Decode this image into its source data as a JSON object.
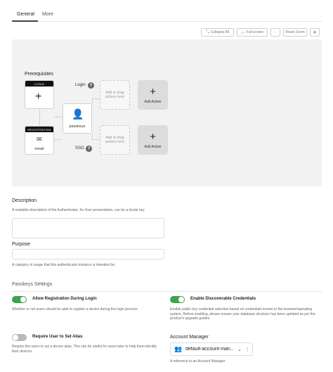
{
  "tabs": [
    {
      "label": "General"
    },
    {
      "label": "More"
    }
  ],
  "toolbar": {
    "collapse_all": "Collapse All",
    "full_screen": "Full screen",
    "more": "⋯",
    "reset_zoom": "Reset Zoom",
    "add": "+"
  },
  "flow": {
    "prerequisites_title": "Prerequisites",
    "login_node_header": "LOGIN",
    "registration_node_header": "REGISTRATION",
    "email_label": "email",
    "passkeys_label": "passkeys",
    "login_label": "Login",
    "sso_label": "SSO",
    "help_glyph": "?",
    "dropzone_text": "Add or drag actions here",
    "add_action_label": "Add Action"
  },
  "form": {
    "description_label": "Description",
    "description_help": "A readable description of the Authenticator, for User presentation, can be a locale key",
    "description_value": "",
    "purpose_label": "Purpose",
    "purpose_value": "",
    "purpose_help": "A category of usage that this authenticator instance is intended for."
  },
  "settings": {
    "section_title": "Passkeys Settings",
    "allow_registration": {
      "label": "Allow Registration During Login",
      "desc": "Whether or not users should be able to register a device during the login process",
      "enabled": true
    },
    "discoverable": {
      "label": "Enable Discoverable Credentials",
      "desc": "Enable public key credential selection based on credentials known to the browser/operating system. Before enabling, please ensure your database structure has been updated as per the product's upgrade guides.",
      "enabled": true
    },
    "require_alias": {
      "label": "Require User to Set Alias",
      "desc": "Require the users to set a device alias. This can be useful for users later to help them identify their devices.",
      "enabled": false
    },
    "account_manager": {
      "label": "Account Manager",
      "value": "default-account-man...",
      "help": "A reference to an Account Manager"
    }
  },
  "colors": {
    "toggle_on": "#3ea44a",
    "toggle_off": "#b9b9b9",
    "node_header": "#111111"
  }
}
